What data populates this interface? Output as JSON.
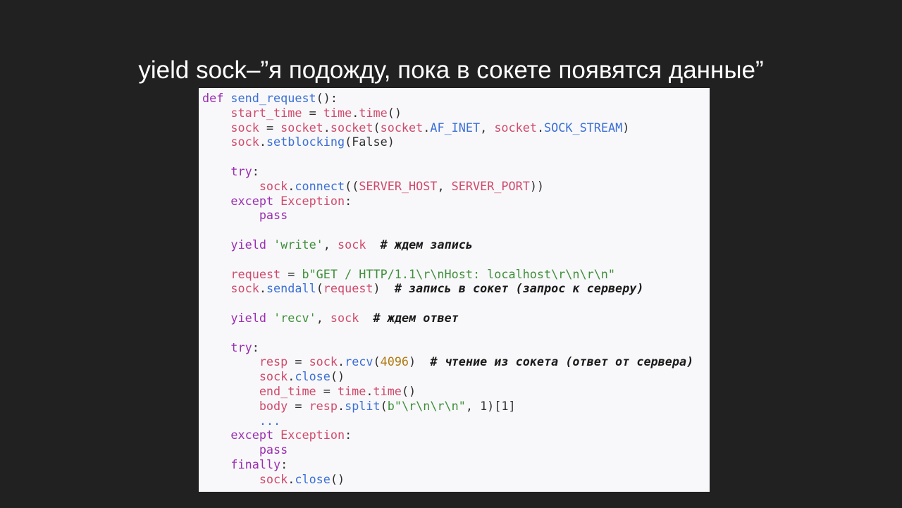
{
  "slide": {
    "title": "yield sock–”я подожду, пока в сокете появятся данные”"
  },
  "code": {
    "lines": [
      [
        [
          "kw",
          "def"
        ],
        [
          "pl",
          " "
        ],
        [
          "fn",
          "send_request"
        ],
        [
          "pl",
          "():"
        ]
      ],
      [
        [
          "pl",
          "    "
        ],
        [
          "var",
          "start_time"
        ],
        [
          "pl",
          " = "
        ],
        [
          "var",
          "time"
        ],
        [
          "pl",
          "."
        ],
        [
          "var",
          "time"
        ],
        [
          "pl",
          "()"
        ]
      ],
      [
        [
          "pl",
          "    "
        ],
        [
          "var",
          "sock"
        ],
        [
          "pl",
          " = "
        ],
        [
          "var",
          "socket"
        ],
        [
          "pl",
          "."
        ],
        [
          "var",
          "socket"
        ],
        [
          "pl",
          "("
        ],
        [
          "var",
          "socket"
        ],
        [
          "pl",
          "."
        ],
        [
          "fn",
          "AF_INET"
        ],
        [
          "pl",
          ", "
        ],
        [
          "var",
          "socket"
        ],
        [
          "pl",
          "."
        ],
        [
          "fn",
          "SOCK_STREAM"
        ],
        [
          "pl",
          ")"
        ]
      ],
      [
        [
          "pl",
          "    "
        ],
        [
          "var",
          "sock"
        ],
        [
          "pl",
          "."
        ],
        [
          "fn",
          "setblocking"
        ],
        [
          "pl",
          "(False)"
        ]
      ],
      [],
      [
        [
          "pl",
          "    "
        ],
        [
          "kw",
          "try"
        ],
        [
          "pl",
          ":"
        ]
      ],
      [
        [
          "pl",
          "        "
        ],
        [
          "var",
          "sock"
        ],
        [
          "pl",
          "."
        ],
        [
          "fn",
          "connect"
        ],
        [
          "pl",
          "(("
        ],
        [
          "var",
          "SERVER_HOST"
        ],
        [
          "pl",
          ", "
        ],
        [
          "var",
          "SERVER_PORT"
        ],
        [
          "pl",
          "))"
        ]
      ],
      [
        [
          "pl",
          "    "
        ],
        [
          "kw",
          "except"
        ],
        [
          "pl",
          " "
        ],
        [
          "var",
          "Exception"
        ],
        [
          "pl",
          ":"
        ]
      ],
      [
        [
          "pl",
          "        "
        ],
        [
          "kw",
          "pass"
        ]
      ],
      [],
      [
        [
          "pl",
          "    "
        ],
        [
          "kw",
          "yield"
        ],
        [
          "pl",
          " "
        ],
        [
          "str",
          "'write'"
        ],
        [
          "pl",
          ", "
        ],
        [
          "var",
          "sock"
        ],
        [
          "pl",
          "  "
        ],
        [
          "cmt",
          "# ждем запись"
        ]
      ],
      [],
      [
        [
          "pl",
          "    "
        ],
        [
          "var",
          "request"
        ],
        [
          "pl",
          " = "
        ],
        [
          "str",
          "b\"GET / HTTP/1.1\\r\\nHost: localhost\\r\\n\\r\\n\""
        ]
      ],
      [
        [
          "pl",
          "    "
        ],
        [
          "var",
          "sock"
        ],
        [
          "pl",
          "."
        ],
        [
          "fn",
          "sendall"
        ],
        [
          "pl",
          "("
        ],
        [
          "var",
          "request"
        ],
        [
          "pl",
          ")  "
        ],
        [
          "cmt",
          "# запись в сокет (запрос к серверу)"
        ]
      ],
      [],
      [
        [
          "pl",
          "    "
        ],
        [
          "kw",
          "yield"
        ],
        [
          "pl",
          " "
        ],
        [
          "str",
          "'recv'"
        ],
        [
          "pl",
          ", "
        ],
        [
          "var",
          "sock"
        ],
        [
          "pl",
          "  "
        ],
        [
          "cmt",
          "# ждем ответ"
        ]
      ],
      [],
      [
        [
          "pl",
          "    "
        ],
        [
          "kw",
          "try"
        ],
        [
          "pl",
          ":"
        ]
      ],
      [
        [
          "pl",
          "        "
        ],
        [
          "var",
          "resp"
        ],
        [
          "pl",
          " = "
        ],
        [
          "var",
          "sock"
        ],
        [
          "pl",
          "."
        ],
        [
          "fn",
          "recv"
        ],
        [
          "pl",
          "("
        ],
        [
          "num",
          "4096"
        ],
        [
          "pl",
          ")  "
        ],
        [
          "cmt",
          "# чтение из сокета (ответ от сервера)"
        ]
      ],
      [
        [
          "pl",
          "        "
        ],
        [
          "var",
          "sock"
        ],
        [
          "pl",
          "."
        ],
        [
          "fn",
          "close"
        ],
        [
          "pl",
          "()"
        ]
      ],
      [
        [
          "pl",
          "        "
        ],
        [
          "var",
          "end_time"
        ],
        [
          "pl",
          " = "
        ],
        [
          "var",
          "time"
        ],
        [
          "pl",
          "."
        ],
        [
          "var",
          "time"
        ],
        [
          "pl",
          "()"
        ]
      ],
      [
        [
          "pl",
          "        "
        ],
        [
          "var",
          "body"
        ],
        [
          "pl",
          " = "
        ],
        [
          "var",
          "resp"
        ],
        [
          "pl",
          "."
        ],
        [
          "fn",
          "split"
        ],
        [
          "pl",
          "("
        ],
        [
          "str",
          "b\"\\r\\n\\r\\n\""
        ],
        [
          "pl",
          ", 1)[1]"
        ]
      ],
      [
        [
          "pl",
          "        "
        ],
        [
          "fn",
          "..."
        ]
      ],
      [
        [
          "pl",
          "    "
        ],
        [
          "kw",
          "except"
        ],
        [
          "pl",
          " "
        ],
        [
          "var",
          "Exception"
        ],
        [
          "pl",
          ":"
        ]
      ],
      [
        [
          "pl",
          "        "
        ],
        [
          "kw",
          "pass"
        ]
      ],
      [
        [
          "pl",
          "    "
        ],
        [
          "kw",
          "finally"
        ],
        [
          "pl",
          ":"
        ]
      ],
      [
        [
          "pl",
          "        "
        ],
        [
          "var",
          "sock"
        ],
        [
          "pl",
          "."
        ],
        [
          "fn",
          "close"
        ],
        [
          "pl",
          "()"
        ]
      ]
    ]
  }
}
